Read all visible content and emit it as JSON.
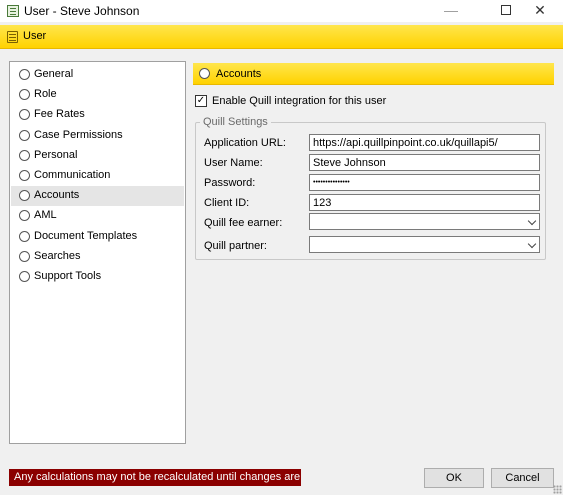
{
  "window": {
    "title": "User - Steve Johnson",
    "controls": {
      "minimize": "—",
      "close": "✕"
    }
  },
  "header": {
    "label": "User",
    "icon": "user-record-icon",
    "color": "#ffd700"
  },
  "nav": {
    "selected_index": 6,
    "items": [
      {
        "label": "General"
      },
      {
        "label": "Role"
      },
      {
        "label": "Fee Rates"
      },
      {
        "label": "Case Permissions"
      },
      {
        "label": "Personal"
      },
      {
        "label": "Communication"
      },
      {
        "label": "Accounts"
      },
      {
        "label": "AML"
      },
      {
        "label": "Document Templates"
      },
      {
        "label": "Searches"
      },
      {
        "label": "Support Tools"
      }
    ]
  },
  "section": {
    "title": "Accounts"
  },
  "integration": {
    "label": "Enable Quill integration for this user",
    "checked": true,
    "check_mark": "✓"
  },
  "quill_settings": {
    "legend": "Quill Settings",
    "application_url": {
      "label": "Application URL:",
      "value": "https://api.quillpinpoint.co.uk/quillapi5/"
    },
    "user_name": {
      "label": "User Name:",
      "value": "Steve Johnson"
    },
    "password": {
      "label": "Password:",
      "value": "•••••••••••••••"
    },
    "client_id": {
      "label": "Client ID:",
      "value": "123"
    },
    "fee_earner": {
      "label": "Quill fee earner:",
      "value": ""
    },
    "partner": {
      "label": "Quill partner:",
      "value": ""
    }
  },
  "status": {
    "message": "Any calculations may not be recalculated until changes are applied",
    "color": "#8b0000"
  },
  "buttons": {
    "ok": "OK",
    "cancel": "Cancel"
  }
}
